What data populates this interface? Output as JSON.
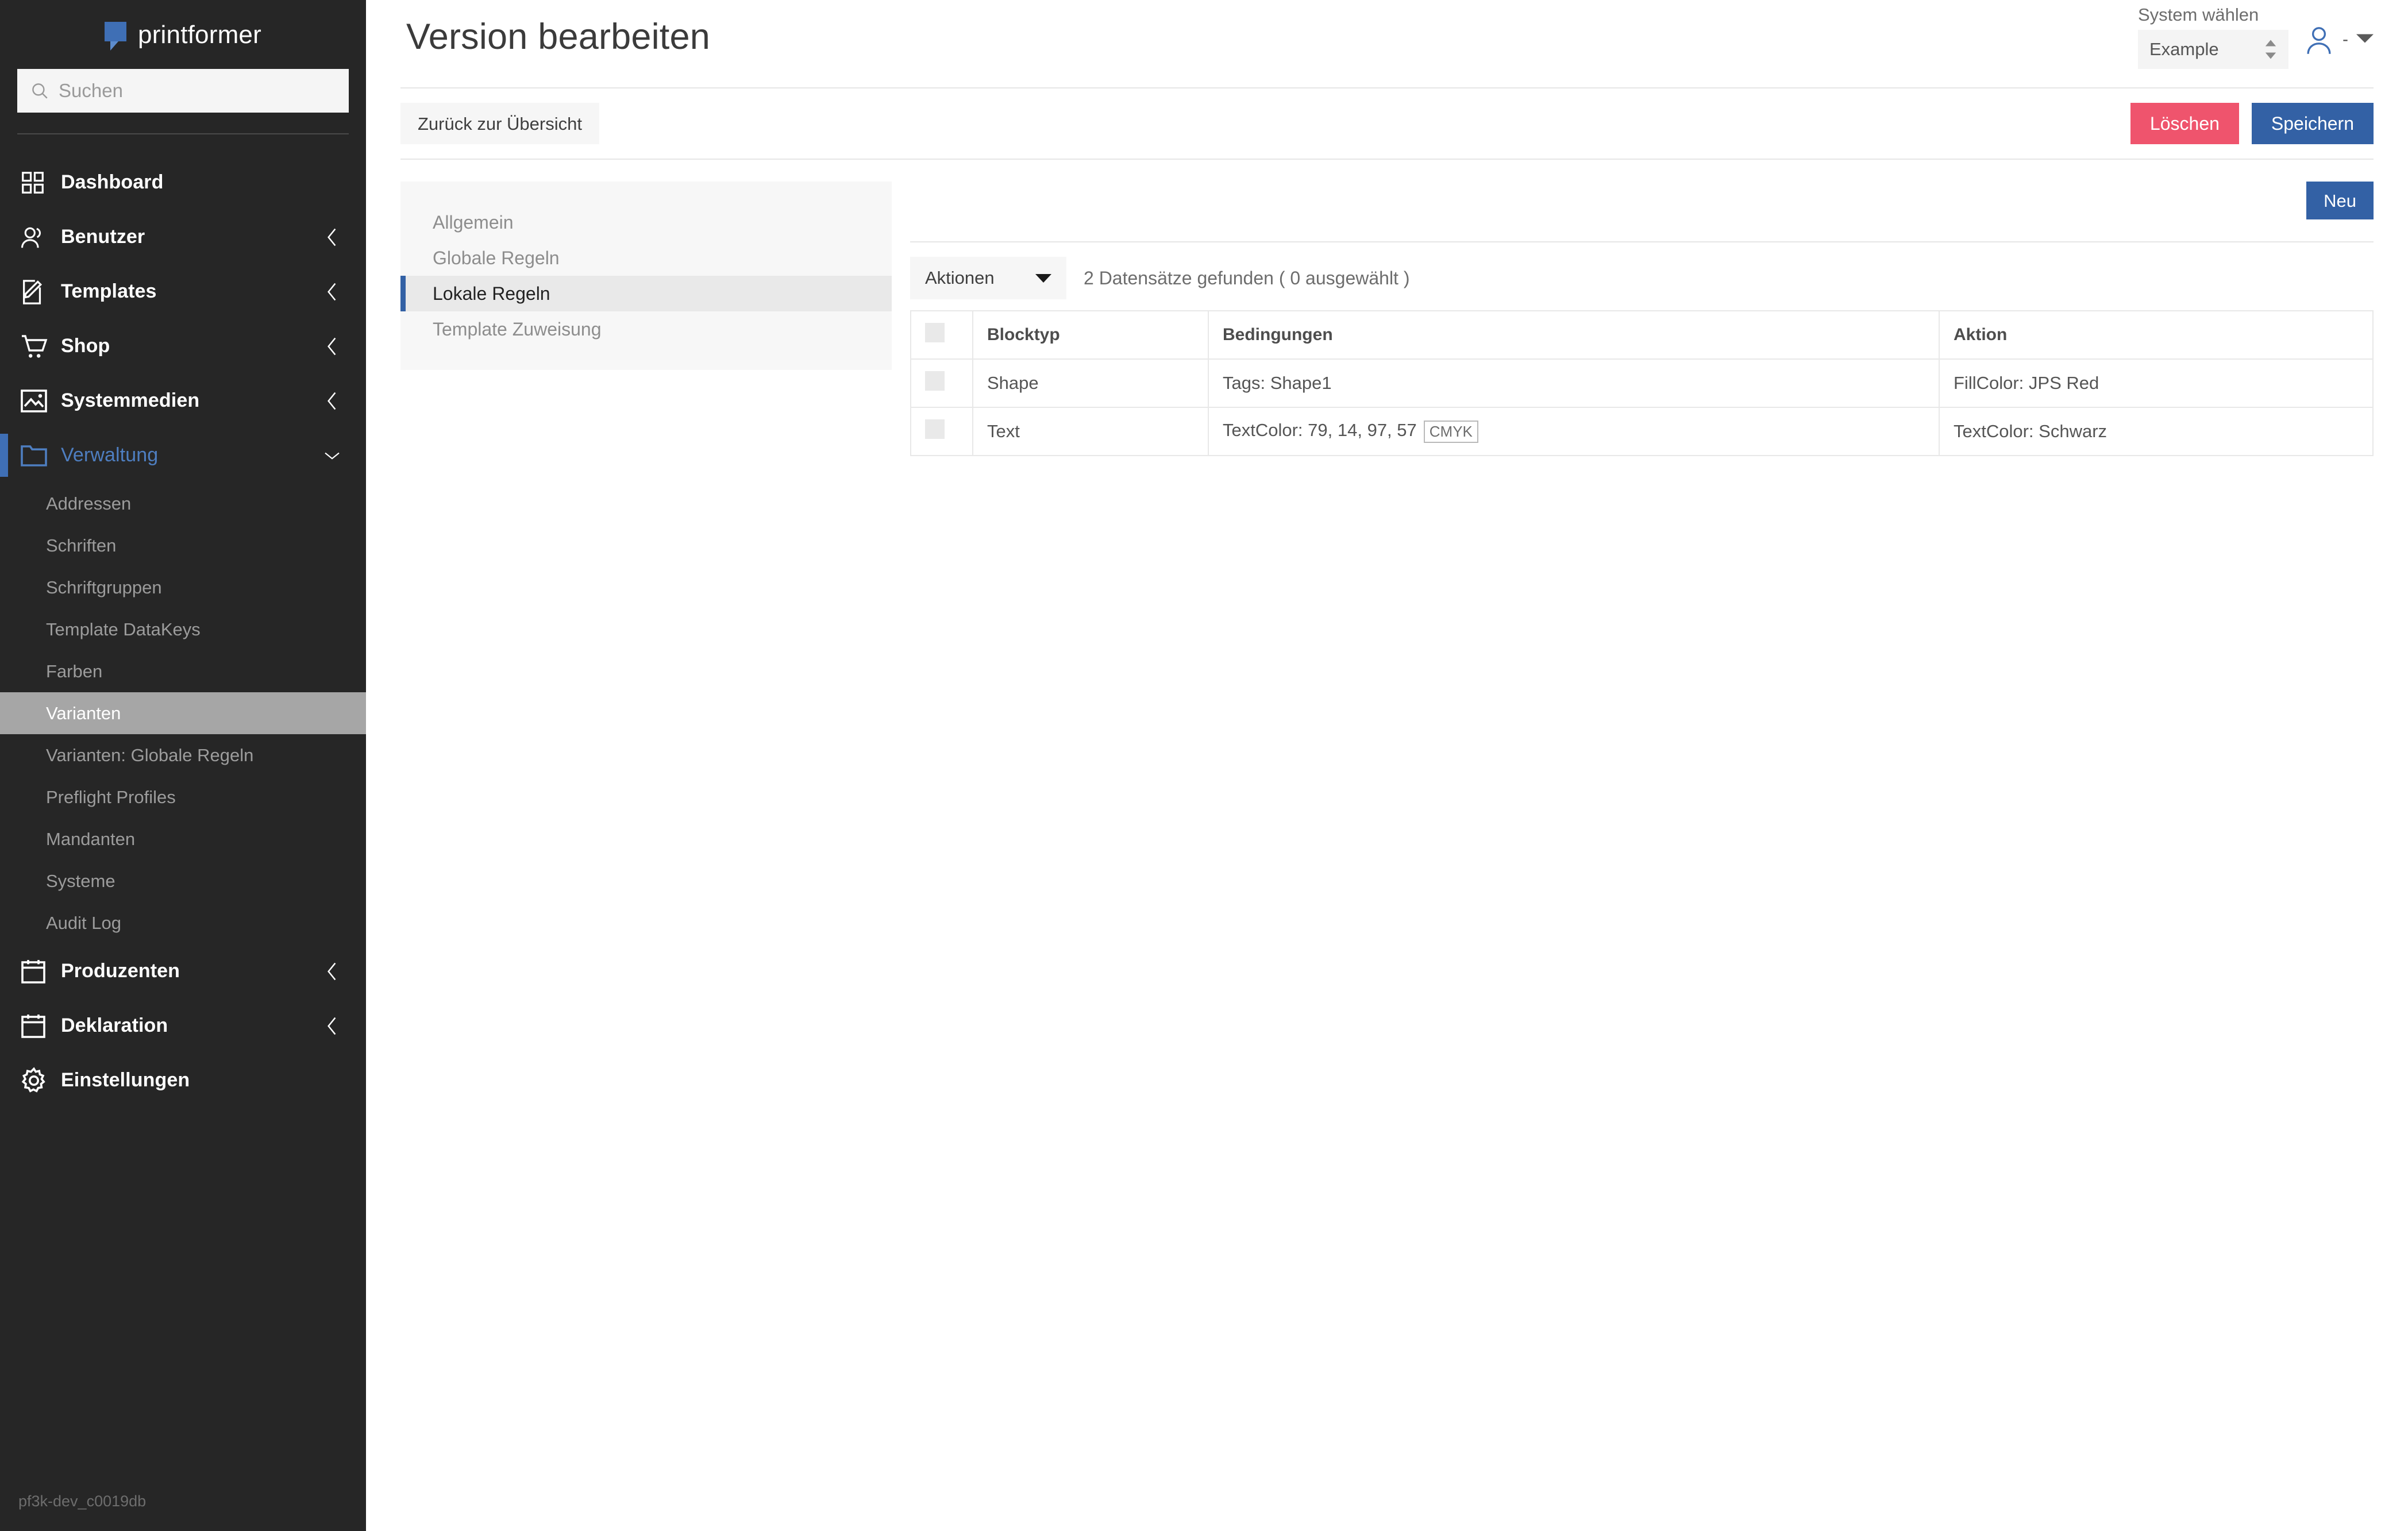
{
  "sidebar": {
    "brand": {
      "name": "printformer"
    },
    "search": {
      "placeholder": "Suchen",
      "value": ""
    },
    "nav": [
      {
        "label": "Dashboard",
        "icon": "grid-icon",
        "chevron": false
      },
      {
        "label": "Benutzer",
        "icon": "users-icon",
        "chevron": true
      },
      {
        "label": "Templates",
        "icon": "edit-document-icon",
        "chevron": true
      },
      {
        "label": "Shop",
        "icon": "cart-icon",
        "chevron": true
      },
      {
        "label": "Systemmedien",
        "icon": "image-icon",
        "chevron": true
      },
      {
        "label": "Verwaltung",
        "icon": "folder-icon",
        "chevron": "down",
        "active": true
      }
    ],
    "subnav": [
      {
        "label": "Addressen"
      },
      {
        "label": "Schriften"
      },
      {
        "label": "Schriftgruppen"
      },
      {
        "label": "Template DataKeys"
      },
      {
        "label": "Farben"
      },
      {
        "label": "Varianten",
        "selected": true
      },
      {
        "label": "Varianten: Globale Regeln"
      },
      {
        "label": "Preflight Profiles"
      },
      {
        "label": "Mandanten"
      },
      {
        "label": "Systeme"
      },
      {
        "label": "Audit Log"
      }
    ],
    "nav_bottom": [
      {
        "label": "Produzenten",
        "icon": "calendar-icon",
        "chevron": true
      },
      {
        "label": "Deklaration",
        "icon": "calendar-icon",
        "chevron": true
      },
      {
        "label": "Einstellungen",
        "icon": "gear-icon",
        "chevron": false
      }
    ],
    "build_tag": "pf3k-dev_c0019db"
  },
  "header": {
    "title": "Version bearbeiten",
    "system_select": {
      "label": "System wählen",
      "value": "Example"
    },
    "user_menu": {
      "separator": "-"
    }
  },
  "toolbar": {
    "back_label": "Zurück zur Übersicht",
    "delete_label": "Löschen",
    "save_label": "Speichern"
  },
  "tabs": [
    {
      "label": "Allgemein",
      "active": false
    },
    {
      "label": "Globale Regeln",
      "active": false
    },
    {
      "label": "Lokale Regeln",
      "active": true
    },
    {
      "label": "Template Zuweisung",
      "active": false
    }
  ],
  "panel": {
    "new_label": "Neu",
    "actions_label": "Aktionen",
    "record_count": "2 Datensätze gefunden ( 0 ausgewählt )"
  },
  "table": {
    "columns": [
      "",
      "Blocktyp",
      "Bedingungen",
      "Aktion"
    ],
    "rows": [
      {
        "checked": false,
        "blocktyp": "Shape",
        "bedingungen": "Tags: Shape1",
        "bedingungen_badge": "",
        "aktion": "FillColor: JPS Red"
      },
      {
        "checked": false,
        "blocktyp": "Text",
        "bedingungen": "TextColor: 79, 14, 97, 57",
        "bedingungen_badge": "CMYK",
        "aktion": "TextColor: Schwarz"
      }
    ]
  },
  "colors": {
    "sidebar_bg": "#262626",
    "accent_blue": "#3361a5",
    "accent_blue_light": "#4e7ec0",
    "danger_red": "#ef546d",
    "panel_bg": "#f7f7f7",
    "selected_sub_bg": "#a6a6a6"
  }
}
